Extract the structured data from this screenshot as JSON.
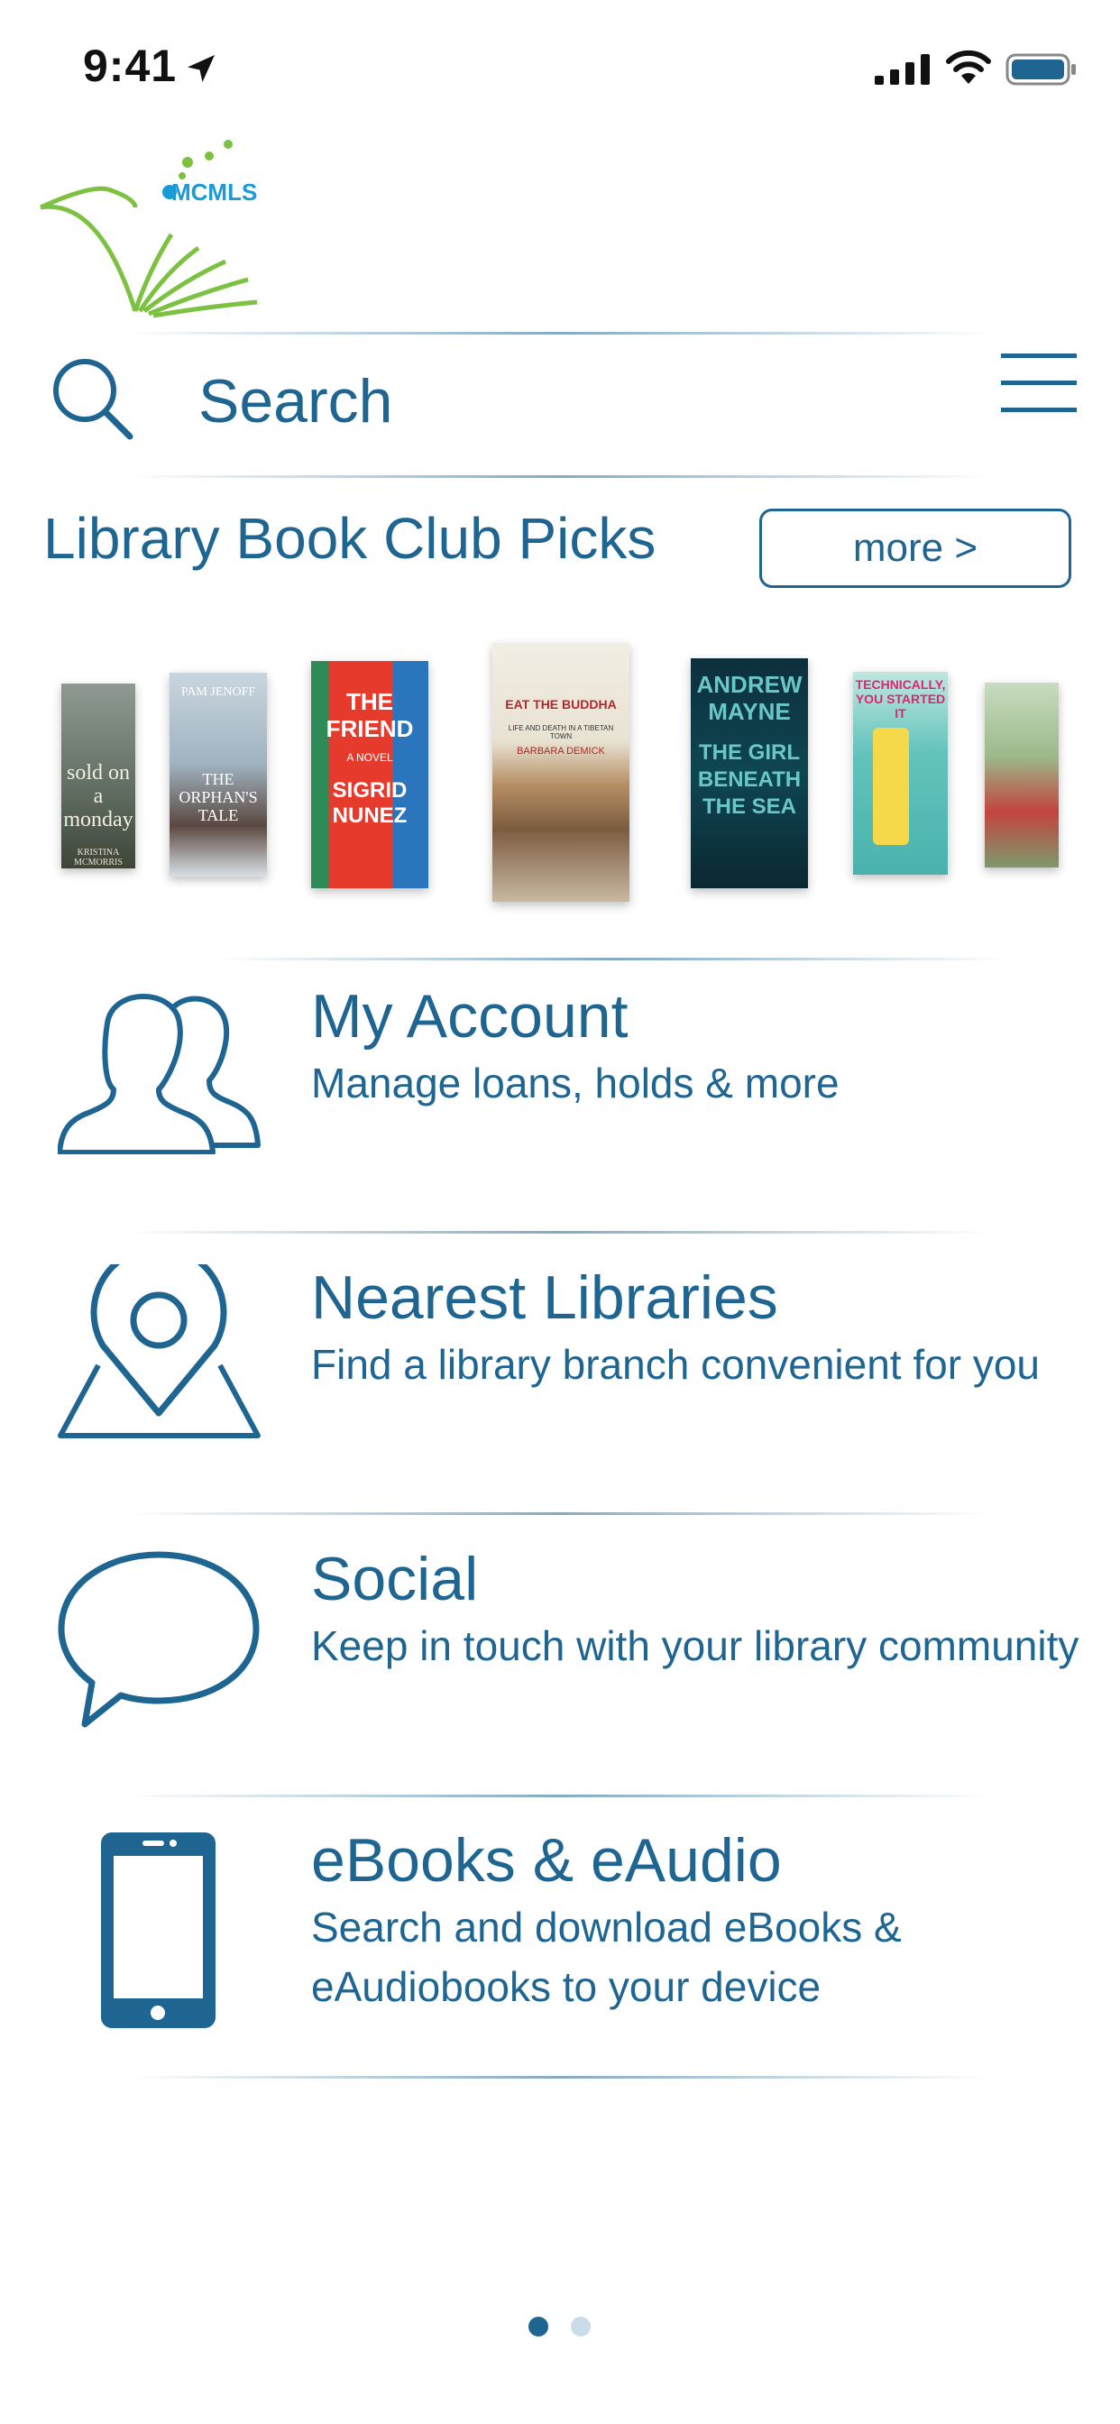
{
  "status_bar": {
    "time": "9:41"
  },
  "logo": {
    "text": "MCMLS"
  },
  "search": {
    "placeholder": "Search"
  },
  "book_club": {
    "title": "Library Book Club Picks",
    "more_label": "more >",
    "books": [
      {
        "title": "sold on a monday",
        "author": "KRISTINA MCMORRIS"
      },
      {
        "title": "THE ORPHAN'S TALE",
        "author": "PAM JENOFF"
      },
      {
        "title": "THE FRIEND",
        "subtitle": "A NOVEL",
        "author": "SIGRID NUNEZ"
      },
      {
        "title": "EAT THE BUDDHA",
        "subtitle": "LIFE AND DEATH IN A TIBETAN TOWN",
        "author": "BARBARA DEMICK"
      },
      {
        "title": "THE GIRL BENEATH THE SEA",
        "author": "ANDREW MAYNE"
      },
      {
        "title": "TECHNICALLY, YOU STARTED IT",
        "author": ""
      },
      {
        "title": "",
        "author": ""
      }
    ]
  },
  "menu": [
    {
      "title": "My Account",
      "subtitle": "Manage loans, holds & more",
      "icon": "users-icon"
    },
    {
      "title": "Nearest Libraries",
      "subtitle": "Find a library branch convenient for you",
      "icon": "map-pin-icon"
    },
    {
      "title": "Social",
      "subtitle": "Keep in touch with your library community",
      "icon": "speech-bubble-icon"
    },
    {
      "title": "eBooks & eAudio",
      "subtitle": "Search and download eBooks & eAudiobooks to your device",
      "icon": "phone-icon"
    }
  ],
  "pagination": {
    "active_page": 1,
    "total_pages": 2
  },
  "colors": {
    "primary": "#1f6592",
    "logo_green": "#7cc142",
    "logo_blue": "#1a9ad6"
  }
}
